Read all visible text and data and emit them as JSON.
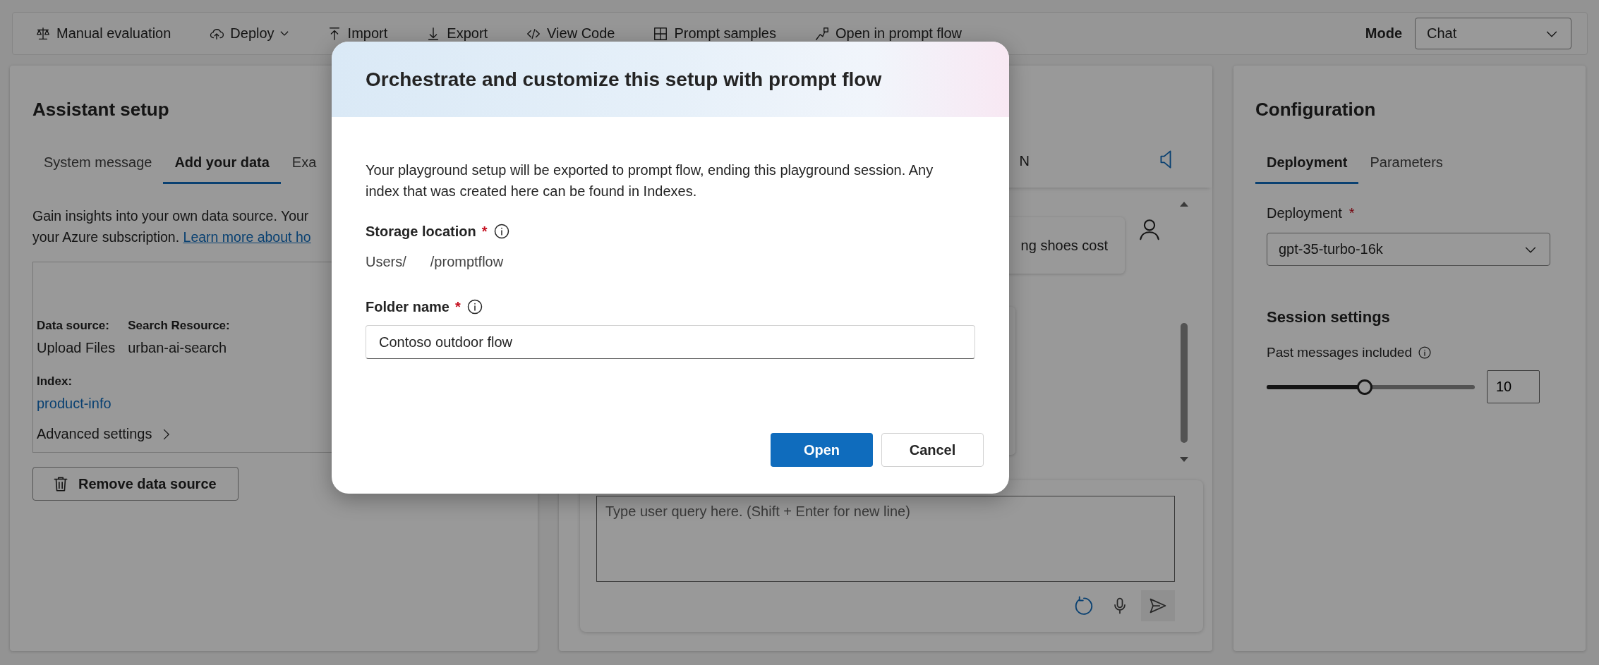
{
  "toolbar": {
    "items": [
      {
        "label": "Manual evaluation",
        "dropdown": false
      },
      {
        "label": "Deploy",
        "dropdown": true
      },
      {
        "label": "Import",
        "dropdown": false
      },
      {
        "label": "Export",
        "dropdown": false
      },
      {
        "label": "View Code",
        "dropdown": false
      },
      {
        "label": "Prompt samples",
        "dropdown": false
      },
      {
        "label": "Open in prompt flow",
        "dropdown": false
      }
    ],
    "mode_label": "Mode",
    "mode_value": "Chat"
  },
  "assistant_setup": {
    "title": "Assistant setup",
    "tabs": [
      {
        "label": "System message",
        "selected": false
      },
      {
        "label": "Add your data",
        "selected": true
      },
      {
        "label": "Exa",
        "selected": false
      }
    ],
    "description": [
      "Gain insights into your own data source. Your",
      "your Azure subscription. "
    ],
    "link": "Learn more about ho",
    "data_source": {
      "fields": [
        {
          "label": "Data source:",
          "value": "Upload Files"
        },
        {
          "label": "Search Resource:",
          "value": "urban-ai-search"
        }
      ],
      "index_label": "Index:",
      "index_value": "product-info",
      "advanced": "Advanced settings"
    },
    "remove_button": "Remove data source"
  },
  "chat": {
    "header_text": "N",
    "user_message": "ng shoes cost",
    "input_placeholder": "Type user query here. (Shift + Enter for new line)"
  },
  "configuration": {
    "title": "Configuration",
    "tabs": [
      {
        "label": "Deployment",
        "selected": true
      },
      {
        "label": "Parameters",
        "selected": false
      }
    ],
    "deployment_label": "Deployment",
    "required_mark": "*",
    "deployment_value": "gpt-35-turbo-16k",
    "session_title": "Session settings",
    "past_messages_label": "Past messages included",
    "past_messages": {
      "level": 0.47,
      "value": "10"
    }
  },
  "dialog": {
    "title": "Orchestrate and customize this setup with prompt flow",
    "body": "Your playground setup will be exported to prompt flow, ending this playground session. Any index that was created here can be found in Indexes.",
    "storage": {
      "label": "Storage location",
      "required_mark": "*",
      "path_prefix": "Users/",
      "path_suffix": "/promptflow"
    },
    "folder": {
      "label": "Folder name",
      "required_mark": "*",
      "value": "Contoso outdoor flow"
    },
    "buttons": [
      {
        "label": "Open",
        "kind": "primary"
      },
      {
        "label": "Cancel",
        "kind": "secondary"
      }
    ]
  }
}
